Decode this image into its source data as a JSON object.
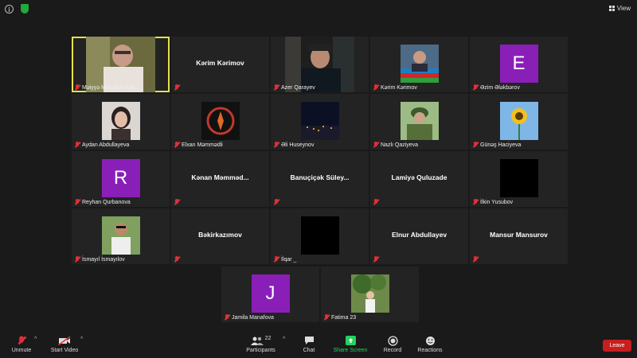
{
  "topbar": {
    "view_label": "View"
  },
  "tiles": [
    {
      "name": "Məiyyə Mühaibat Fak...",
      "type": "video",
      "highlight": true
    },
    {
      "name": "Kərim Kərimov",
      "type": "name"
    },
    {
      "name": "Azer Qarayev",
      "type": "video"
    },
    {
      "name": "Kərim Kərimov",
      "type": "photo",
      "icon": "flag-portrait"
    },
    {
      "name": "Əzim Ələkbərov",
      "type": "letter",
      "letter": "E"
    },
    {
      "name": "Aydan Abdullayeva",
      "type": "photo",
      "icon": "portrait"
    },
    {
      "name": "Elxan Məmmədli",
      "type": "photo",
      "icon": "emblem"
    },
    {
      "name": "Əli Huseynov",
      "type": "photo",
      "icon": "night-city"
    },
    {
      "name": "Nazlı Qaziyeva",
      "type": "photo",
      "icon": "soldier"
    },
    {
      "name": "Günəş Haciyeva",
      "type": "photo",
      "icon": "sunflower"
    },
    {
      "name": "Reyhan Qurbanova",
      "type": "letter",
      "letter": "R"
    },
    {
      "name": "Kənan  Məmməd...",
      "type": "name"
    },
    {
      "name": "Banuçiçək  Süley...",
      "type": "name"
    },
    {
      "name": "Lamiyə Quluzade",
      "type": "name"
    },
    {
      "name": "İlkin Yusubov",
      "type": "black"
    },
    {
      "name": "İsmayıl İsmayılov",
      "type": "photo",
      "icon": "portrait-outdoor"
    },
    {
      "name": "Bəkirkazımov",
      "type": "name"
    },
    {
      "name": "İlqar _",
      "type": "black"
    },
    {
      "name": "Elnur Abdullayev",
      "type": "name"
    },
    {
      "name": "Mansur Mansurov",
      "type": "name"
    },
    {
      "name": "Jamila Manafova",
      "type": "letter",
      "letter": "J"
    },
    {
      "name": "Fatima 23",
      "type": "photo",
      "icon": "tree-portrait"
    }
  ],
  "toolbar": {
    "unmute": "Unmute",
    "start_video": "Start Video",
    "participants": "Participants",
    "participants_count": "22",
    "chat": "Chat",
    "share_screen": "Share Screen",
    "record": "Record",
    "reactions": "Reactions",
    "leave": "Leave"
  },
  "colors": {
    "accent_green": "#23d160",
    "leave_red": "#c81e1e",
    "highlight": "#e6e14a",
    "avatar_purple": "#8a1fb8"
  }
}
